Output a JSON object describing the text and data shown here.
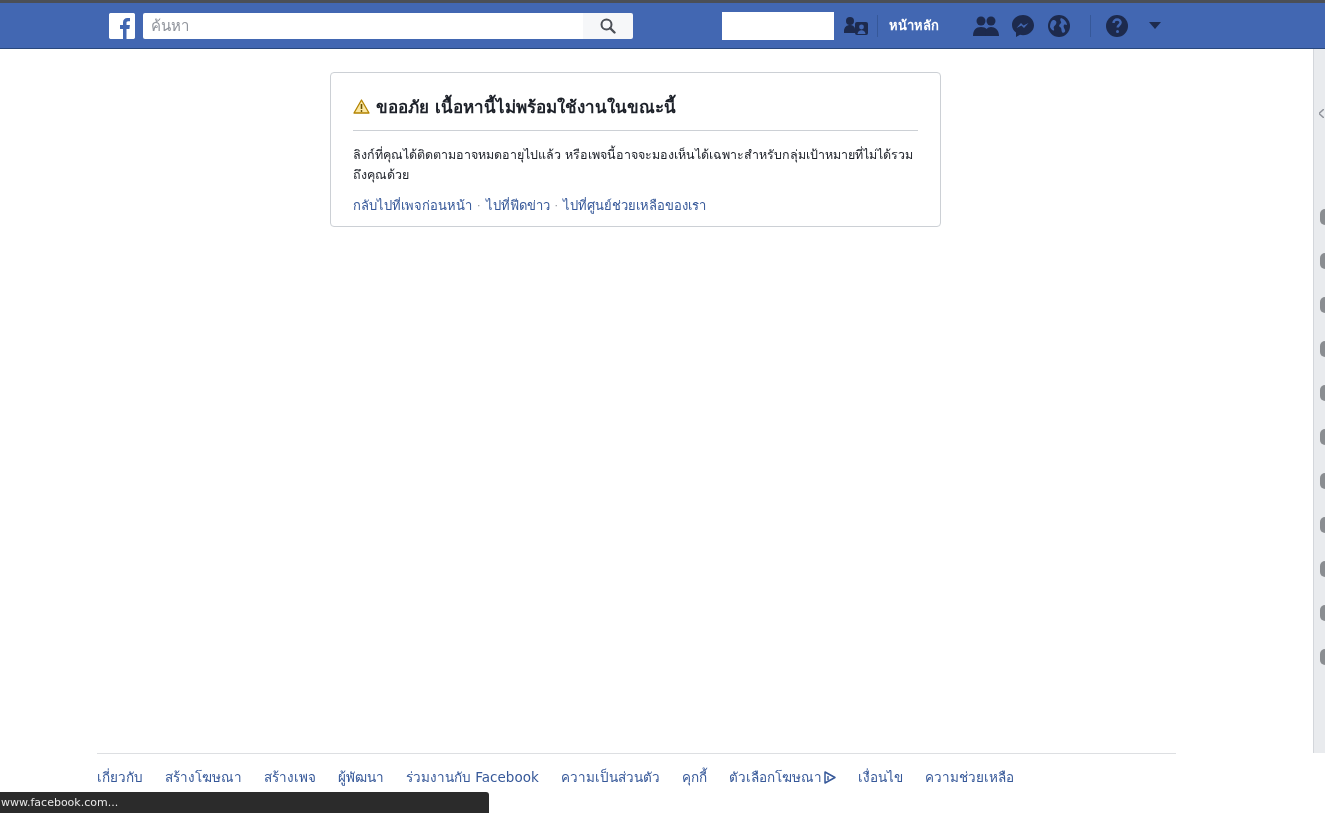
{
  "top_bar": {
    "search": {
      "placeholder": "ค้นหา"
    },
    "nav_link": "หน้าหลัก"
  },
  "notice": {
    "title": "ขออภัย เนื้อหานี้ไม่พร้อมใช้งานในขณะนี้",
    "message": "ลิงก์ที่คุณได้ติดตามอาจหมดอายุไปแล้ว หรือเพจนี้อาจจะมองเห็นได้เฉพาะสำหรับกลุ่มเป้าหมายที่ไม่ได้รวมถึงคุณด้วย",
    "separator": "·",
    "links": [
      "กลับไปที่เพจก่อนหน้า",
      "ไปที่ฟีดข่าว",
      "ไปที่ศูนย์ช่วยเหลือของเรา"
    ]
  },
  "footer_links": [
    {
      "label": "เกี่ยวกับ",
      "kind": "link"
    },
    {
      "label": "สร้างโฆษณา",
      "kind": "link"
    },
    {
      "label": "สร้างเพจ",
      "kind": "link"
    },
    {
      "label": "ผู้พัฒนา",
      "kind": "link"
    },
    {
      "label": "ร่วมงานกับ Facebook",
      "kind": "link"
    },
    {
      "label": "ความเป็นส่วนตัว",
      "kind": "link"
    },
    {
      "label": "คุกกี้",
      "kind": "link"
    },
    {
      "label": "ตัวเลือกโฆษณา",
      "kind": "ad_choices"
    },
    {
      "label": "เงื่อนไข",
      "kind": "link"
    },
    {
      "label": "ความช่วยเหลือ",
      "kind": "link"
    }
  ],
  "status_bar": {
    "url": "www.facebook.com..."
  }
}
